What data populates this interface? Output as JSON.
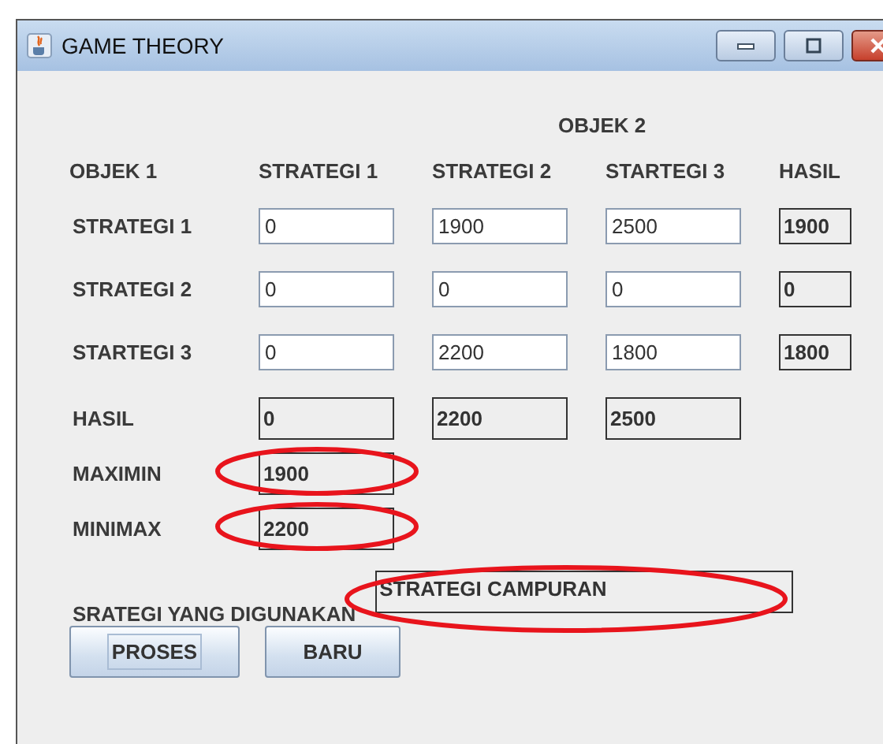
{
  "window": {
    "title": "GAME THEORY"
  },
  "group_header": "OBJEK 2",
  "columns": [
    "OBJEK 1",
    "STRATEGI 1",
    "STRATEGI 2",
    "STARTEGI 3",
    "HASIL"
  ],
  "rows": [
    {
      "label": "STRATEGI 1",
      "values": [
        "0",
        "1900",
        "2500"
      ],
      "result": "1900"
    },
    {
      "label": "STRATEGI 2",
      "values": [
        "0",
        "0",
        "0"
      ],
      "result": "0"
    },
    {
      "label": "STARTEGI 3",
      "values": [
        "0",
        "2200",
        "1800"
      ],
      "result": "1800"
    }
  ],
  "hasil_row": {
    "label": "HASIL",
    "values": [
      "0",
      "2200",
      "2500"
    ]
  },
  "results": [
    {
      "label": "MAXIMIN",
      "value": "1900",
      "circled": true
    },
    {
      "label": "MINIMAX",
      "value": "2200",
      "circled": true
    }
  ],
  "strategy": {
    "label": "SRATEGI YANG DIGUNAKAN",
    "value": "STRATEGI CAMPURAN",
    "circled": true
  },
  "buttons": [
    {
      "label": "PROSES",
      "focused": true
    },
    {
      "label": "BARU",
      "focused": false
    }
  ]
}
